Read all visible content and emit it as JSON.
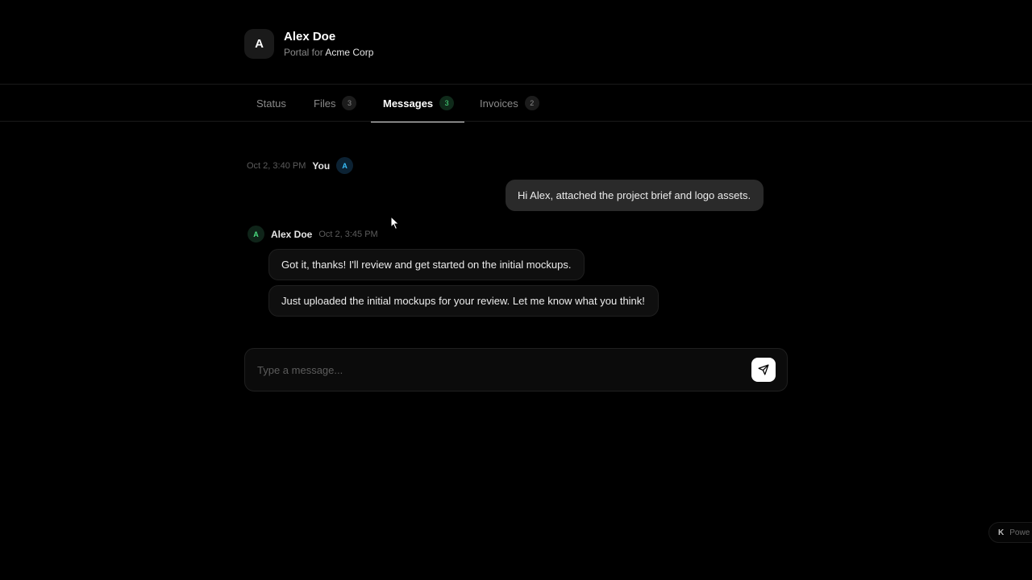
{
  "header": {
    "avatar_initial": "A",
    "client_name": "Alex Doe",
    "portal_prefix": "Portal for",
    "company": "Acme Corp"
  },
  "tabs": [
    {
      "label": "Status",
      "count": null,
      "active": false
    },
    {
      "label": "Files",
      "count": "3",
      "active": false
    },
    {
      "label": "Messages",
      "count": "3",
      "active": true
    },
    {
      "label": "Invoices",
      "count": "2",
      "active": false
    }
  ],
  "messages": [
    {
      "time": "Oct 2, 3:40 PM",
      "author": "You",
      "avatar": "A",
      "bubbles": [
        "Hi Alex, attached the project brief and logo assets."
      ]
    },
    {
      "time": "Oct 2, 3:45 PM",
      "author": "Alex Doe",
      "avatar": "A",
      "bubbles": [
        "Got it, thanks! I'll review and get started on the initial mockups.",
        "Just uploaded the initial mockups for your review. Let me know what you think!"
      ]
    }
  ],
  "composer": {
    "placeholder": "Type a message...",
    "send_icon": "send-icon"
  },
  "footer": {
    "powered_logo": "K",
    "powered_text": "Powe"
  },
  "colors": {
    "background": "#000000",
    "accent_green": "#4ade80",
    "accent_blue": "#38bdf8"
  }
}
